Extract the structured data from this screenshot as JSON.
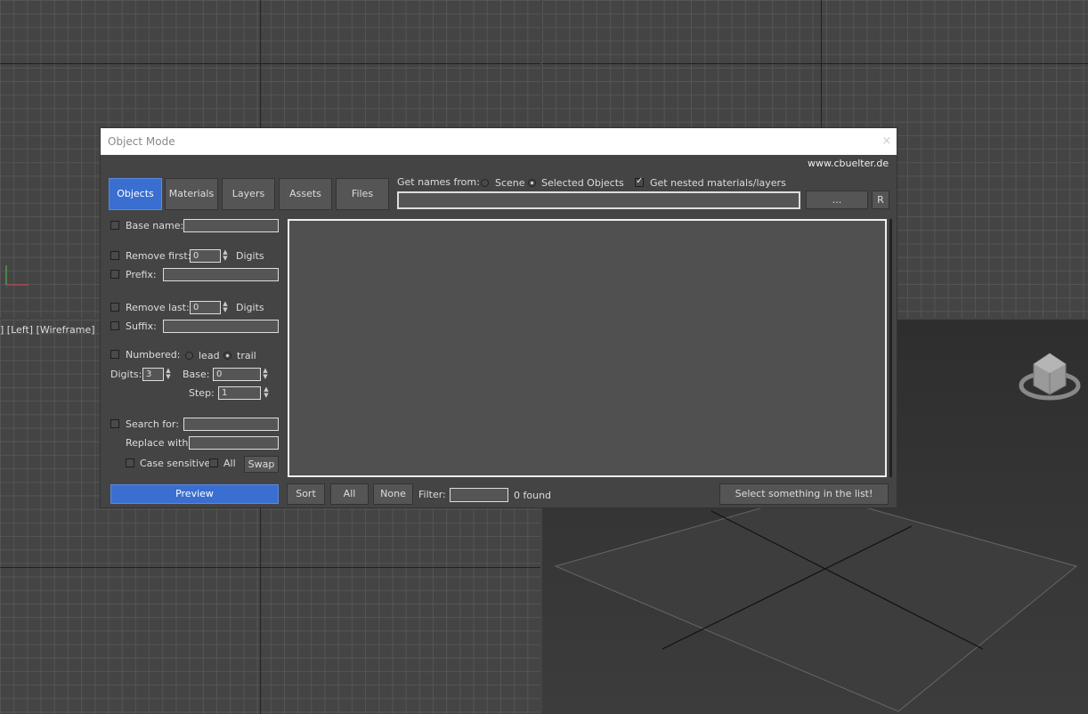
{
  "viewport": {
    "label_left": "]",
    "label_view": "[Left]",
    "label_mode": "[Wireframe]"
  },
  "dialog": {
    "title": "Object Mode",
    "close_label": "×",
    "website": "www.cbuelter.de",
    "tabs": [
      "Objects",
      "Materials",
      "Layers",
      "Assets",
      "Files"
    ],
    "active_tab": "Objects",
    "get_names": {
      "label": "Get names from:",
      "scene_label": "Scene",
      "selected_label": "Selected Objects",
      "selected": "Selected Objects",
      "nested_label": "Get nested materials/layers",
      "nested_checked": true,
      "path_value": "",
      "browse_label": "...",
      "reset_label": "R"
    },
    "options": {
      "base_name_label": "Base name:",
      "base_name_value": "",
      "remove_first_label": "Remove first:",
      "remove_first_value": "0",
      "digits_unit": "Digits",
      "prefix_label": "Prefix:",
      "prefix_value": "",
      "remove_last_label": "Remove last:",
      "remove_last_value": "0",
      "suffix_label": "Suffix:",
      "suffix_value": "",
      "numbered_label": "Numbered:",
      "lead_label": "lead",
      "trail_label": "trail",
      "numbered_position": "trail",
      "digits_label": "Digits:",
      "digits_value": "3",
      "base_label": "Base:",
      "base_value": "0",
      "step_label": "Step:",
      "step_value": "1",
      "search_label": "Search for:",
      "search_value": "",
      "replace_label": "Replace with:",
      "replace_value": "",
      "case_label": "Case sensitive",
      "all_label": "All",
      "swap_label": "Swap"
    },
    "bottom": {
      "preview_label": "Preview",
      "sort_label": "Sort",
      "all_label": "All",
      "none_label": "None",
      "filter_label": "Filter:",
      "filter_value": "",
      "found_text": "0 found",
      "status_label": "Select something in the list!"
    }
  }
}
